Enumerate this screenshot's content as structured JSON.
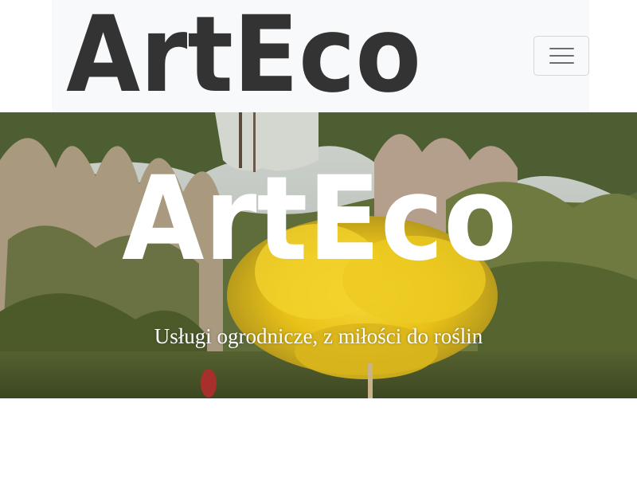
{
  "navbar": {
    "logo_text": "ArtEco",
    "toggler_icon": "hamburger-menu-icon",
    "logo_color": "#333333"
  },
  "hero": {
    "logo_text": "ArtEco",
    "tagline": "Usługi ogrodnicze, z miłości do roślin",
    "logo_color": "#ffffff"
  }
}
